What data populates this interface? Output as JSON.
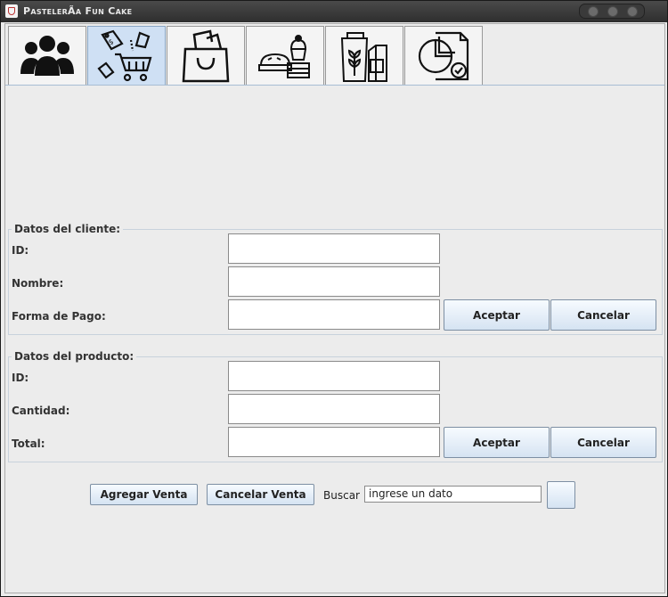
{
  "window": {
    "title": "PastelerÃ­a Fun Cake"
  },
  "tabs": [
    {
      "icon": "users-icon"
    },
    {
      "icon": "sale-tags-cart-icon",
      "selected": true
    },
    {
      "icon": "shopping-bag-icon"
    },
    {
      "icon": "pastries-icon"
    },
    {
      "icon": "grocery-products-icon"
    },
    {
      "icon": "report-chart-icon"
    }
  ],
  "cliente": {
    "legend": "Datos del cliente:",
    "id_label": "ID:",
    "nombre_label": "Nombre:",
    "pago_label": "Forma de Pago:",
    "id_value": "",
    "nombre_value": "",
    "pago_value": "",
    "accept": "Aceptar",
    "cancel": "Cancelar"
  },
  "producto": {
    "legend": "Datos del producto:",
    "id_label": "ID:",
    "cantidad_label": "Cantidad:",
    "total_label": "Total:",
    "id_value": "",
    "cantidad_value": "",
    "total_value": "",
    "accept": "Aceptar",
    "cancel": "Cancelar"
  },
  "actions": {
    "add_sale": "Agregar Venta",
    "cancel_sale": "Cancelar Venta",
    "search_label": "Buscar",
    "search_value": "ingrese un dato"
  }
}
